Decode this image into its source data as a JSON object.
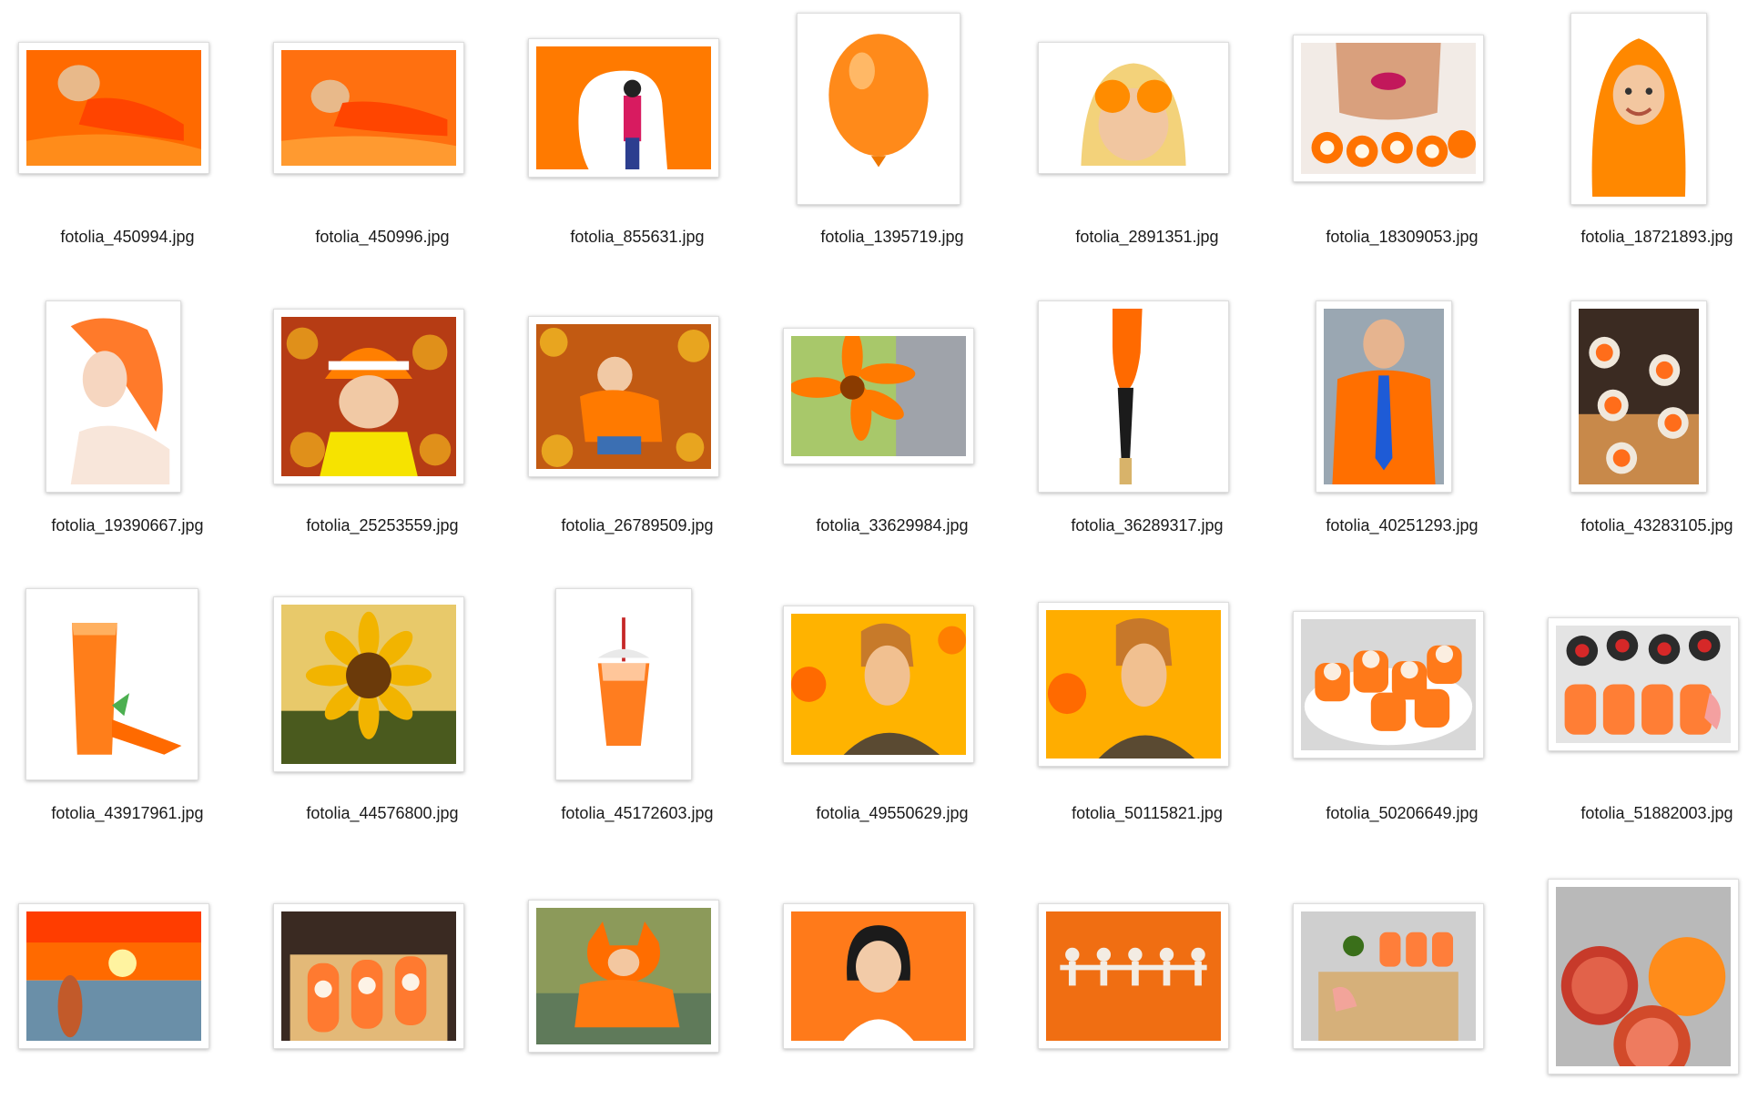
{
  "files": [
    {
      "name": "fotolia_450994.jpg",
      "thumb": "woman-orange-fur-icon"
    },
    {
      "name": "fotolia_450996.jpg",
      "thumb": "woman-orange-fur-2-icon"
    },
    {
      "name": "fotolia_855631.jpg",
      "thumb": "girl-painting-wall-icon"
    },
    {
      "name": "fotolia_1395719.jpg",
      "thumb": "orange-balloon-icon"
    },
    {
      "name": "fotolia_2891351.jpg",
      "thumb": "woman-orange-eyes-icon"
    },
    {
      "name": "fotolia_18309053.jpg",
      "thumb": "woman-eating-sushi-icon"
    },
    {
      "name": "fotolia_18721893.jpg",
      "thumb": "child-orange-towel-icon"
    },
    {
      "name": "fotolia_19390667.jpg",
      "thumb": "redhead-woman-icon"
    },
    {
      "name": "fotolia_25253559.jpg",
      "thumb": "girl-autumn-leaves-icon"
    },
    {
      "name": "fotolia_26789509.jpg",
      "thumb": "child-autumn-leaves-icon"
    },
    {
      "name": "fotolia_33629984.jpg",
      "thumb": "orange-gerbera-icon"
    },
    {
      "name": "fotolia_36289317.jpg",
      "thumb": "paintbrush-icon"
    },
    {
      "name": "fotolia_40251293.jpg",
      "thumb": "man-orange-shirt-icon"
    },
    {
      "name": "fotolia_43283105.jpg",
      "thumb": "sushi-rolls-board-icon"
    },
    {
      "name": "fotolia_43917961.jpg",
      "thumb": "carrot-juice-icon"
    },
    {
      "name": "fotolia_44576800.jpg",
      "thumb": "sunflower-icon"
    },
    {
      "name": "fotolia_45172603.jpg",
      "thumb": "smoothie-cup-icon"
    },
    {
      "name": "fotolia_49550629.jpg",
      "thumb": "woman-orange-background-icon"
    },
    {
      "name": "fotolia_50115821.jpg",
      "thumb": "woman-orange-background-2-icon"
    },
    {
      "name": "fotolia_50206649.jpg",
      "thumb": "sushi-plate-icon"
    },
    {
      "name": "fotolia_51882003.jpg",
      "thumb": "sushi-assortment-icon"
    },
    {
      "name": "",
      "thumb": "sunset-beach-icon"
    },
    {
      "name": "",
      "thumb": "salmon-rolls-icon"
    },
    {
      "name": "",
      "thumb": "baby-fox-costume-icon"
    },
    {
      "name": "",
      "thumb": "smiling-woman-orange-icon"
    },
    {
      "name": "",
      "thumb": "paper-dolls-icon"
    },
    {
      "name": "",
      "thumb": "sushi-wood-board-icon"
    },
    {
      "name": "",
      "thumb": "blood-oranges-icon"
    }
  ]
}
